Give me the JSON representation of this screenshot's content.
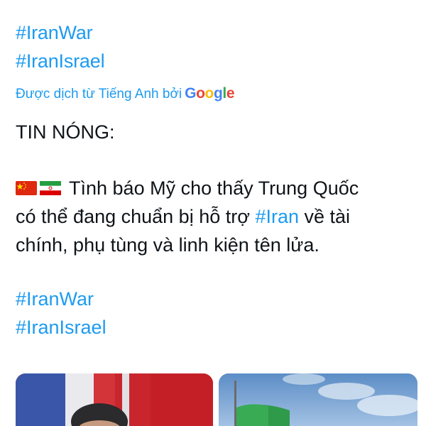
{
  "post": {
    "hashtags_top": [
      "#IranWar",
      "#IranIsrael"
    ],
    "translation_note": "Được dịch từ Tiếng Anh bởi",
    "translation_provider": "Google",
    "breaking_label": "TIN NÓNG:",
    "body_line_1": " Tình báo Mỹ cho thấy Trung Quốc",
    "body_line_2_pre": "có thể đang chuẩn bị hỗ trợ ",
    "body_inline_hashtag": "#Iran",
    "body_line_2_post": " về tài",
    "body_line_3": "chính, phụ tùng và linh kiện tên lửa.",
    "flags": [
      "china-flag",
      "iran-flag"
    ],
    "hashtags_bottom": [
      "#IranWar",
      "#IranIsrael"
    ]
  },
  "colors": {
    "link": "#1d9bf0",
    "text": "#0f1419",
    "background": "#ffffff"
  },
  "media": {
    "images": [
      "photo-leader-with-flags",
      "photo-iran-flag-sky"
    ]
  }
}
